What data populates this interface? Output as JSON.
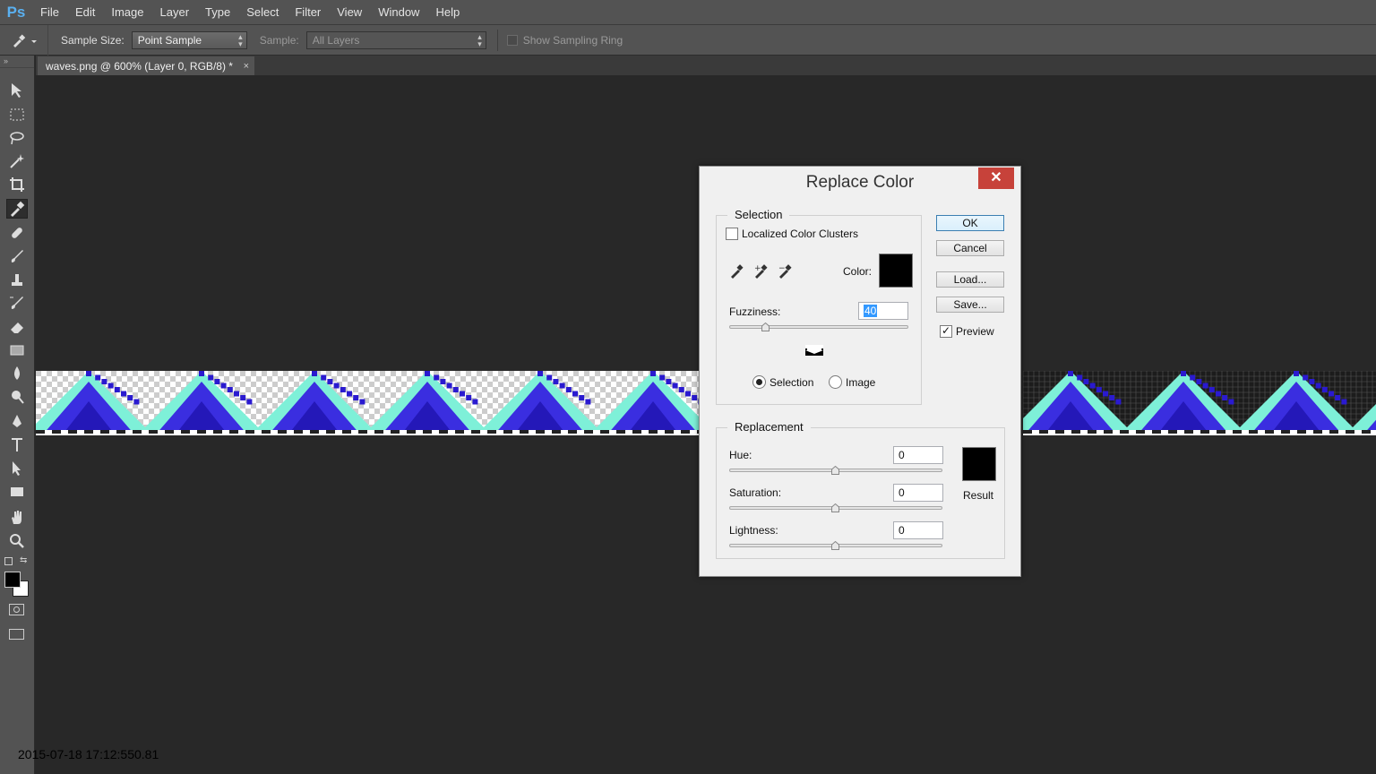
{
  "app": {
    "logo": "Ps",
    "colors": {
      "accent": "#5ab0f0",
      "close": "#c7423a"
    }
  },
  "menu": [
    "File",
    "Edit",
    "Image",
    "Layer",
    "Type",
    "Select",
    "Filter",
    "View",
    "Window",
    "Help"
  ],
  "options": {
    "tool_icon": "eyedropper-icon",
    "sample_size_label": "Sample Size:",
    "sample_size_value": "Point Sample",
    "sample_label": "Sample:",
    "sample_value": "All Layers",
    "sampling_ring_label": "Show Sampling Ring"
  },
  "tools": [
    "move-icon",
    "marquee-icon",
    "lasso-icon",
    "magic-wand-icon",
    "crop-icon",
    "eyedropper-icon",
    "healing-brush-icon",
    "brush-icon",
    "clone-stamp-icon",
    "history-brush-icon",
    "eraser-icon",
    "gradient-icon",
    "blur-icon",
    "dodge-icon",
    "pen-icon",
    "type-icon",
    "path-selection-icon",
    "rectangle-icon",
    "hand-icon",
    "zoom-icon"
  ],
  "document": {
    "tab_title": "waves.png @ 600% (Layer 0, RGB/8) *",
    "close": "×"
  },
  "dialog": {
    "title": "Replace Color",
    "close": "✕",
    "selection": {
      "group_label": "Selection",
      "localized_label": "Localized Color Clusters",
      "localized_checked": false,
      "color_label": "Color:",
      "color": "#000000",
      "fuzziness_label": "Fuzziness:",
      "fuzziness_value": "40",
      "fuzziness_slider": 0.2,
      "radio_selection": "Selection",
      "radio_image": "Image",
      "selected_mode": "Selection"
    },
    "replacement": {
      "group_label": "Replacement",
      "hue_label": "Hue:",
      "hue_value": "0",
      "saturation_label": "Saturation:",
      "saturation_value": "0",
      "lightness_label": "Lightness:",
      "lightness_value": "0",
      "result_label": "Result",
      "result_color": "#000000"
    },
    "buttons": {
      "ok": "OK",
      "cancel": "Cancel",
      "load": "Load...",
      "save": "Save...",
      "preview": "Preview",
      "preview_checked": true
    }
  },
  "timestamp": "2015-07-18 17:12:550.81"
}
